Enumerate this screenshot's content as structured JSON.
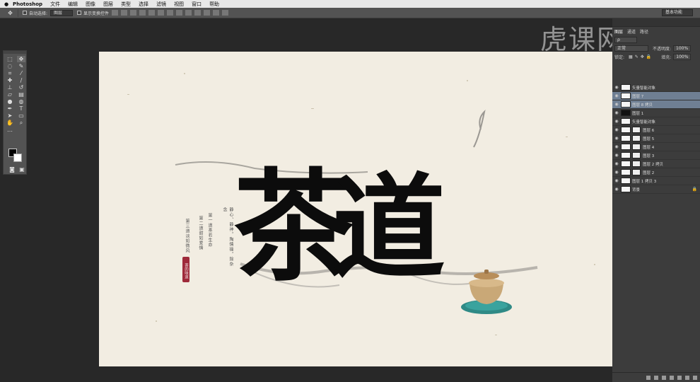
{
  "menubar": {
    "apple": "",
    "items": [
      "Photoshop",
      "文件",
      "编辑",
      "图像",
      "图层",
      "类型",
      "选择",
      "滤镜",
      "视图",
      "窗口",
      "帮助"
    ]
  },
  "options": {
    "auto_select_label": "自动选择:",
    "auto_select_value": "图层",
    "show_transform_label": "显示变换控件",
    "workspace": "基本功能"
  },
  "watermark": "虎课网",
  "canvas": {
    "title_chars": [
      "茶",
      "道"
    ],
    "vertical_texts": [
      "静心、静神，陶情操，除杂念",
      "第一道茶若生命",
      "第二道甜如爱情",
      "第三道淡如微风"
    ],
    "seal_text": "茶的味道"
  },
  "layers_panel": {
    "tabs": [
      "图层",
      "通道",
      "路径"
    ],
    "blend_mode": "正常",
    "opacity_label": "不透明度:",
    "opacity_value": "100%",
    "lock_label": "锁定:",
    "fill_label": "填充:",
    "fill_value": "100%",
    "layers": [
      {
        "name": "矢量智能对象",
        "selected": false
      },
      {
        "name": "图层 7",
        "selected": true
      },
      {
        "name": "图层 8 拷贝",
        "selected": true
      },
      {
        "name": "图层 1",
        "selected": false
      },
      {
        "name": "矢量智能对象",
        "selected": false
      },
      {
        "name": "图层 6",
        "selected": false
      },
      {
        "name": "图层 5",
        "selected": false
      },
      {
        "name": "图层 4",
        "selected": false
      },
      {
        "name": "图层 3",
        "selected": false
      },
      {
        "name": "图层 2 拷贝",
        "selected": false
      },
      {
        "name": "图层 2",
        "selected": false
      },
      {
        "name": "图层 1 拷贝 3",
        "selected": false
      },
      {
        "name": "背景",
        "selected": false
      }
    ]
  }
}
